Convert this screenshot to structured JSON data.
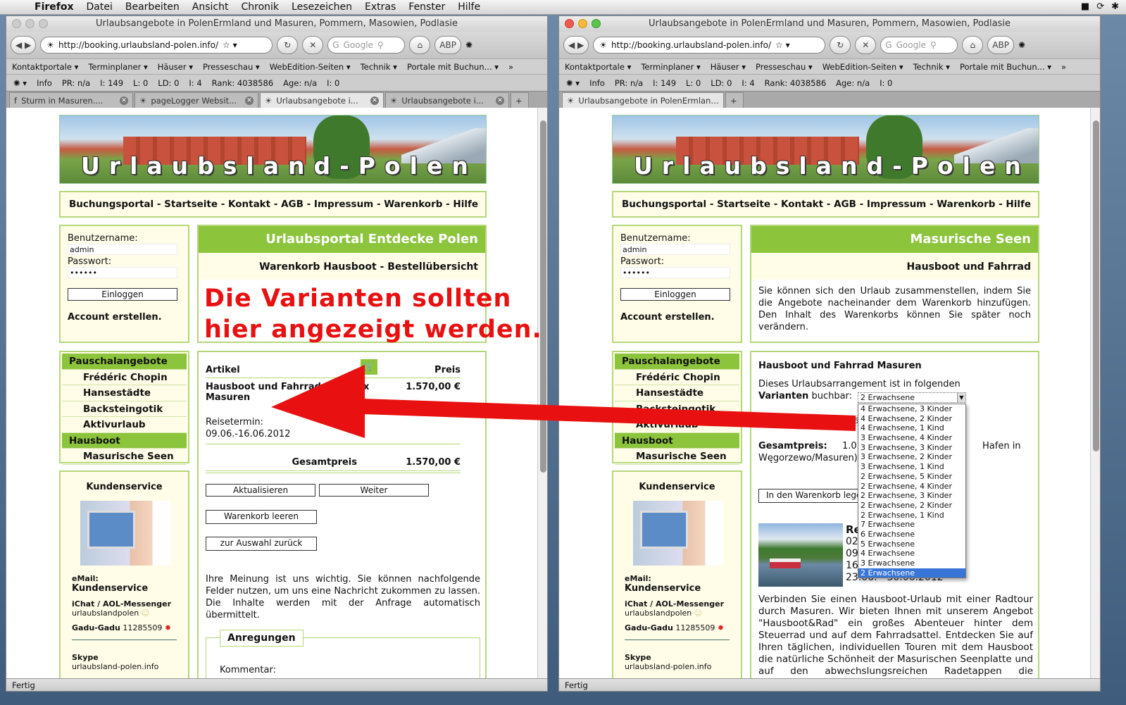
{
  "menubar": {
    "app": "Firefox",
    "items": [
      "Datei",
      "Bearbeiten",
      "Ansicht",
      "Chronik",
      "Lesezeichen",
      "Extras",
      "Fenster",
      "Hilfe"
    ]
  },
  "chrome": {
    "url": "http://booking.urlaubsland-polen.info/",
    "search_placeholder": "Google",
    "bookmarks": [
      "Kontaktportale ▾",
      "Terminplaner ▾",
      "Häuser ▾",
      "Presseschau ▾",
      "WebEdition-Seiten ▾",
      "Technik ▾",
      "Portale mit Buchun... ▾",
      "»"
    ],
    "addons": [
      "Info",
      "PR: n/a",
      "I: 149",
      "L: 0",
      "LD: 0",
      "I: 4",
      "Rank: 4038586",
      "Age: n/a",
      "I: 0"
    ]
  },
  "windows": [
    {
      "title": "Urlaubsangebote in PolenErmland und Masuren, Pommern, Masowien, Podlasie",
      "status": "Fertig",
      "tabs": [
        {
          "label": "Sturm in Masuren....",
          "active": false
        },
        {
          "label": "pageLogger Websit...",
          "active": false
        },
        {
          "label": "Urlaubsangebote i...",
          "active": true
        },
        {
          "label": "Urlaubsangebote i...",
          "active": false
        }
      ]
    },
    {
      "title": "Urlaubsangebote in PolenErmland und Masuren, Pommern, Masowien, Podlasie",
      "status": "Fertig",
      "tabs": [
        {
          "label": "Urlaubsangebote in PolenErmland...",
          "active": true
        }
      ]
    }
  ],
  "site": {
    "logo": "Urlaubsland-Polen",
    "nav": "Buchungsportal - Startseite - Kontakt - AGB - Impressum - Warenkorb - Hilfe",
    "login": {
      "user_label": "Benutzername:",
      "user_value": "admin",
      "pass_label": "Passwort:",
      "pass_value": "••••••",
      "button": "Einloggen",
      "create": "Account erstellen."
    },
    "menu": [
      "Pauschalangebote",
      "Frédéric Chopin",
      "Hansestädte",
      "Backsteingotik",
      "Aktivurlaub",
      "Hausboot",
      "Masurische Seen"
    ],
    "kunden": {
      "title": "Kundenservice",
      "email_label": "eMail:",
      "email_value": "Kundenservice",
      "ichat_label": "iChat / AOL-Messenger",
      "ichat_value": "urlaubslandpolen",
      "gadu_label": "Gadu-Gadu",
      "gadu_value": "11285509",
      "skype_label": "Skype",
      "skype_value": "urlaubsland-polen.info"
    }
  },
  "left_page": {
    "header": "Urlaubsportal Entdecke Polen",
    "subtitle": "Warenkorb Hausboot - Bestellübersicht",
    "col_article": "Artikel",
    "col_price": "Preis",
    "item_name": "Hausboot und Fahrrad Masuren",
    "item_remove": "x",
    "item_price": "1.570,00 €",
    "date_label": "Reisetermin:",
    "date_value": "09.06.-16.06.2012",
    "total_label": "Gesamtpreis",
    "total_value": "1.570,00 €",
    "buttons": {
      "update": "Aktualisieren",
      "next": "Weiter",
      "clear": "Warenkorb leeren",
      "back": "zur Auswahl zurück"
    },
    "feedback": "Ihre Meinung ist uns wichtig. Sie können nachfolgende Felder nutzen, um uns eine Nachricht zukommen zu lassen. Die Inhalte werden mit der Anfrage automatisch übermittelt.",
    "fieldset": "Anregungen",
    "comment_label": "Kommentar:"
  },
  "right_page": {
    "header": "Masurische Seen",
    "subtitle": "Hausboot und Fahrrad",
    "intro": "Sie können sich den Urlaub zusammenstellen, indem Sie die Angebote nacheinander dem Warenkorb hinzufügen. Den Inhalt des Warenkorbs können Sie später noch verändern.",
    "offer_title": "Hausboot und Fahrrad Masuren",
    "variants_text": "Dieses Urlaubsarrangement ist in folgenden",
    "variants_bold": "Varianten",
    "variants_rest": "buchbar:",
    "variant_selected": "2 Erwachsene",
    "variant_options": [
      "4 Erwachsene, 3 Kinder",
      "4 Erwachsene, 2 Kinder",
      "4 Erwachsene, 1 Kind",
      "3 Erwachsene, 4 Kinder",
      "3 Erwachsene, 3 Kinder",
      "3 Erwachsene, 2 Kinder",
      "3 Erwachsene, 1 Kind",
      "2 Erwachsene, 5 Kinder",
      "2 Erwachsene, 4 Kinder",
      "2 Erwachsene, 3 Kinder",
      "2 Erwachsene, 2 Kinder",
      "2 Erwachsene, 1 Kind",
      "7 Erwachsene",
      "6 Erwachsene",
      "5 Erwachsene",
      "4 Erwachsene",
      "3 Erwachsene",
      "2 Erwachsene"
    ],
    "dates_label": "Reisetermine:",
    "dates_value": "02.06",
    "total_label": "Gesamtpreis:",
    "total_value": "1.0",
    "total_rest": "Hafen in",
    "total_rest2": "Węgorzewo/Masuren)",
    "cart_button": "In den Warenkorb lege",
    "dates_head": "Re",
    "dates": [
      "02",
      "09",
      "16",
      "23.06. - 30.06.2012"
    ],
    "description": "Verbinden Sie einen Hausboot-Urlaub mit einer Radtour durch Masuren. Wir bieten Ihnen mit unserem Angebot \"Hausboot&Rad\" ein großes Abenteuer hinter dem Steuerrad und auf dem Fahrradsattel. Entdecken Sie auf Ihren täglichen, individuellen Touren mit dem Hausboot die natürliche Schönheit der Masurischen Seenplatte und auf den abwechslungsreichen Radetappen die malerische"
  },
  "annotation": {
    "line1": "Die Varianten sollten",
    "line2": "hier angezeigt werden.",
    "color": "#e81010"
  },
  "colors": {
    "green": "#8cc43c",
    "panel": "#fffde8",
    "border": "#b5d77a",
    "selection": "#3875d7"
  }
}
